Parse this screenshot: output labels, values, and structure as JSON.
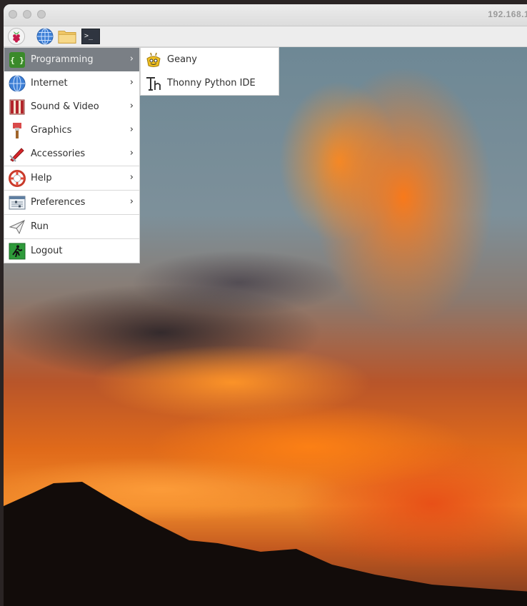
{
  "window": {
    "title": "192.168.1."
  },
  "panel": {
    "icons": [
      "raspberry-icon",
      "globe-icon",
      "folder-icon",
      "terminal-icon"
    ],
    "terminal_glyph": ">_"
  },
  "menu": {
    "items": [
      {
        "label": "Programming",
        "icon": "programming-icon"
      },
      {
        "label": "Internet",
        "icon": "internet-icon"
      },
      {
        "label": "Sound & Video",
        "icon": "sound-video-icon"
      },
      {
        "label": "Graphics",
        "icon": "graphics-icon"
      },
      {
        "label": "Accessories",
        "icon": "accessories-icon"
      },
      {
        "label": "Help",
        "icon": "help-icon"
      },
      {
        "label": "Preferences",
        "icon": "preferences-icon"
      },
      {
        "label": "Run",
        "icon": "run-icon"
      },
      {
        "label": "Logout",
        "icon": "logout-icon"
      }
    ],
    "arrow": "›"
  },
  "submenu": {
    "items": [
      {
        "label": "Geany",
        "icon": "geany-icon"
      },
      {
        "label": "Thonny Python IDE",
        "icon": "thonny-icon"
      }
    ]
  },
  "colors": {
    "menu_highlight": "#7a7f85",
    "panel": "#ededed"
  }
}
